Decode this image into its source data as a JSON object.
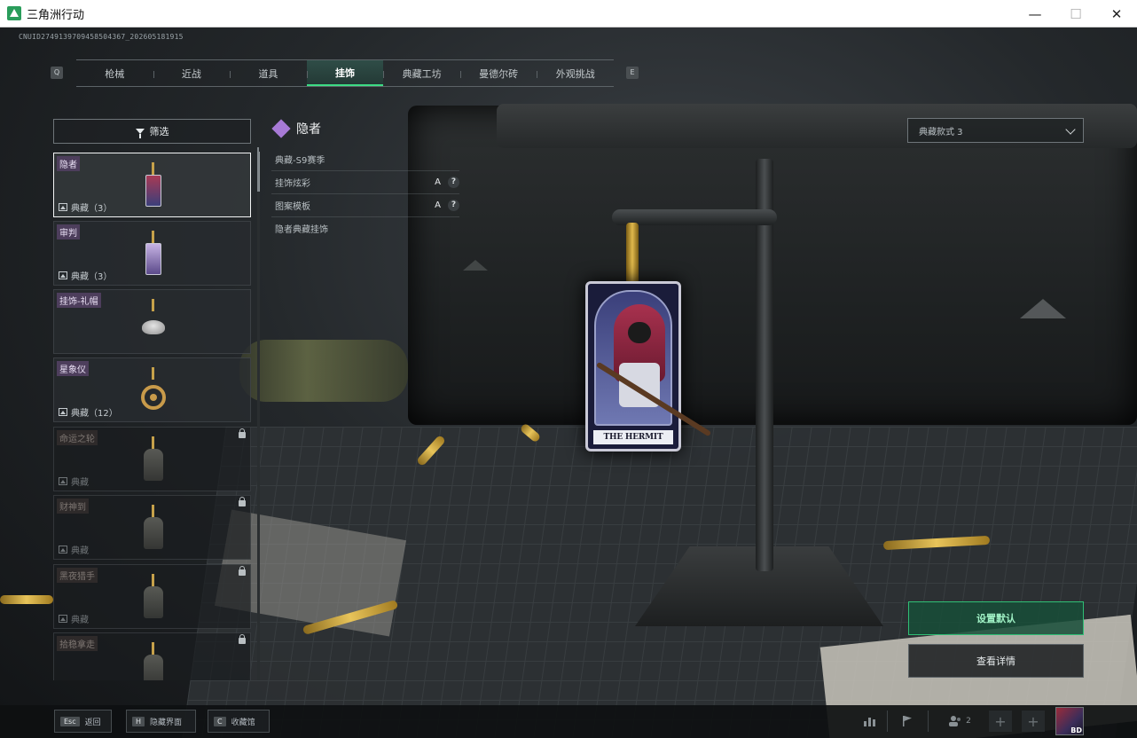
{
  "window": {
    "title": "三角洲行动",
    "minimize": "—",
    "maximize": "☐",
    "close": "✕"
  },
  "session_id": "CNUID2749139709458504367_202605181915",
  "tabs": {
    "left_key": "Q",
    "right_key": "E",
    "items": [
      {
        "label": "枪械",
        "active": false
      },
      {
        "label": "近战",
        "active": false
      },
      {
        "label": "道具",
        "active": false
      },
      {
        "label": "挂饰",
        "active": true
      },
      {
        "label": "典藏工坊",
        "active": false
      },
      {
        "label": "曼德尔砖",
        "active": false
      },
      {
        "label": "外观挑战",
        "active": false
      }
    ]
  },
  "filter": {
    "label": "筛选"
  },
  "items": [
    {
      "name": "隐者",
      "meta": "典藏（3）",
      "thumb": "tarot-card-charm",
      "locked": false,
      "selected": true
    },
    {
      "name": "审判",
      "meta": "典藏（3）",
      "thumb": "tarot-card-charm-purple",
      "locked": false,
      "selected": false
    },
    {
      "name": "挂饰-礼帽",
      "meta": "",
      "thumb": "top-hat-charm",
      "locked": false,
      "selected": false
    },
    {
      "name": "星象仪",
      "meta": "典藏（12）",
      "thumb": "astrolabe-charm",
      "locked": false,
      "selected": false
    },
    {
      "name": "命运之轮",
      "meta": "典藏",
      "thumb": "wheel-charm",
      "locked": true,
      "selected": false
    },
    {
      "name": "财神到",
      "meta": "典藏",
      "thumb": "fortune-charm",
      "locked": true,
      "selected": false
    },
    {
      "name": "黑夜猎手",
      "meta": "典藏",
      "thumb": "hunter-charm",
      "locked": true,
      "selected": false
    },
    {
      "name": "拾稳拿走",
      "meta": "",
      "thumb": "figure-charm",
      "locked": true,
      "selected": false
    }
  ],
  "detail": {
    "title": "隐者",
    "rows": [
      {
        "label": "典藏-S9赛季",
        "grade": ""
      },
      {
        "label": "挂饰炫彩",
        "grade": "A"
      },
      {
        "label": "图案模板",
        "grade": "A"
      },
      {
        "label": "隐者典藏挂饰",
        "grade": ""
      }
    ],
    "help": "?"
  },
  "charm_label": "THE HERMIT",
  "style_select": {
    "value": "典藏款式 3"
  },
  "buttons": {
    "set_default": "设置默认",
    "view_details": "查看详情"
  },
  "bottom": {
    "esc": {
      "key": "Esc",
      "label": "返回"
    },
    "hide": {
      "key": "H",
      "label": "隐藏界面"
    },
    "collection": {
      "key": "C",
      "label": "收藏馆"
    },
    "party_count": "2",
    "add": "+",
    "avatar_tag": "BD"
  },
  "colors": {
    "accent": "#3ddc84",
    "rarity": "#a77ad6"
  }
}
